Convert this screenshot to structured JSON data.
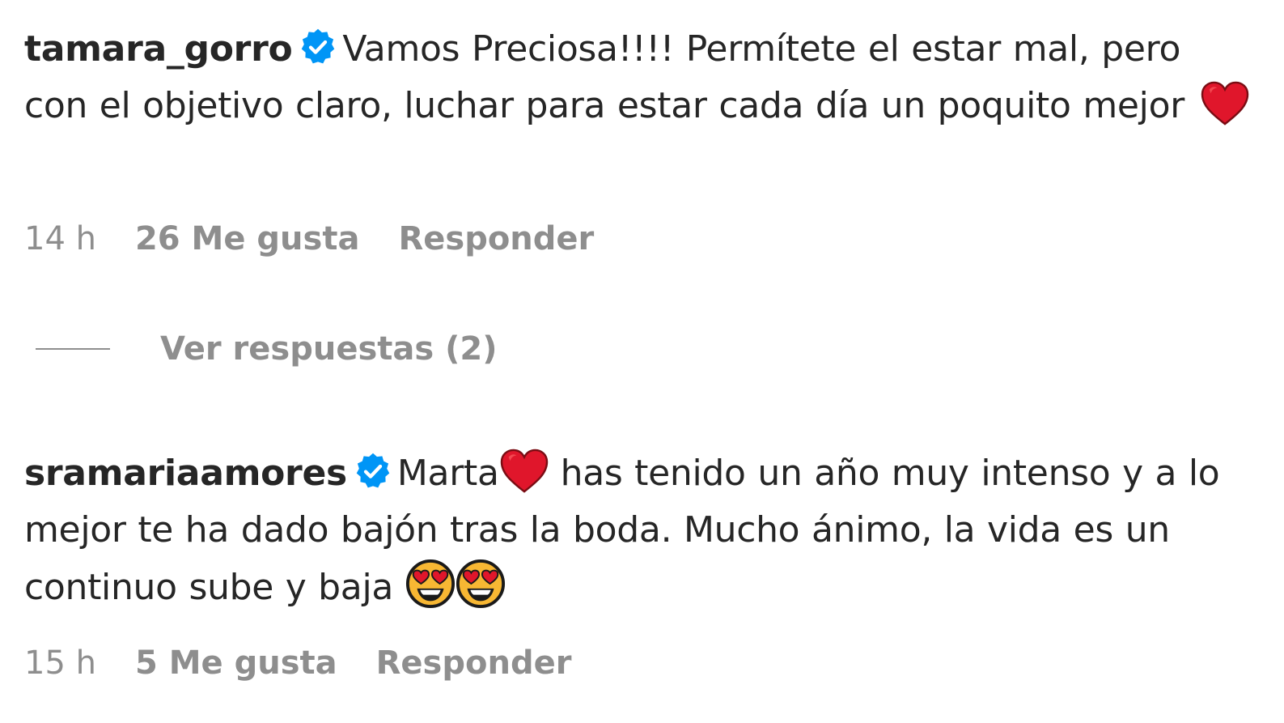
{
  "comments": [
    {
      "username": "tamara_gorro",
      "verified": true,
      "text": "Vamos Preciosa!!!! Permítete el estar mal, pero con el objetivo claro, luchar para estar cada día un poquito mejor",
      "emojis": [
        "red-heart"
      ],
      "time": "14 h",
      "likes": "26 Me gusta",
      "reply_label": "Responder",
      "view_replies": "Ver respuestas (2)"
    },
    {
      "username": "sramariaamores",
      "verified": true,
      "text_before_emoji": "Marta",
      "text_after_emoji": "has tenido un año muy intenso y a lo mejor te ha dado bajón tras la boda. Mucho ánimo, la vida es un continuo sube y baja",
      "emojis": [
        "red-heart",
        "heart-eyes",
        "heart-eyes"
      ],
      "time": "15 h",
      "likes": "5 Me gusta",
      "reply_label": "Responder"
    }
  ],
  "colors": {
    "text": "#262626",
    "secondary": "#8e8e8e",
    "verified_badge": "#0095f6",
    "heart": "#e0162b"
  }
}
